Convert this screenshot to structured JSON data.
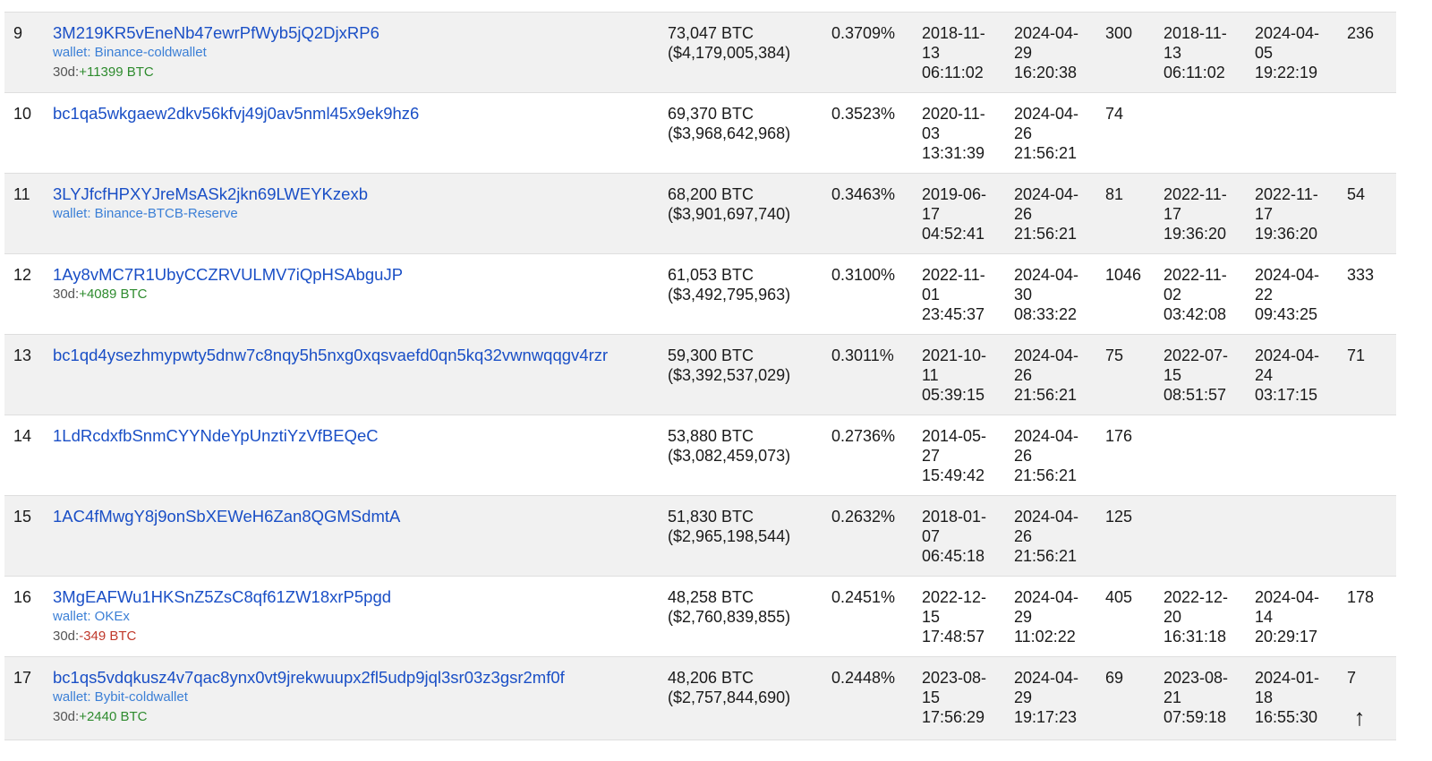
{
  "colors": {
    "link": "#1a4fc6",
    "wallet": "#3b7fd6",
    "positive": "#2e8b2e",
    "negative": "#c0392b",
    "row_shade": "#f1f1f1"
  },
  "rows": [
    {
      "rank": "9",
      "address": "3M219KR5vEneNb47ewrPfWyb5jQ2DjxRP6",
      "wallet": "wallet: Binance-coldwallet",
      "delta_prefix": "30d:",
      "delta": "+11399 BTC",
      "delta_sign": "pos",
      "balance": "73,047 BTC\n($4,179,005,384)",
      "pct": "0.3709%",
      "first_in": "2018-11-\n13\n06:11:02",
      "last_in": "2024-04-\n29\n16:20:38",
      "ins": "300",
      "first_out": "2018-11-\n13\n06:11:02",
      "last_out": "2024-04-\n05\n19:22:19",
      "outs": "236"
    },
    {
      "rank": "10",
      "address": "bc1qa5wkgaew2dkv56kfvj49j0av5nml45x9ek9hz6",
      "wallet": "",
      "delta_prefix": "",
      "delta": "",
      "delta_sign": "",
      "balance": "69,370 BTC\n($3,968,642,968)",
      "pct": "0.3523%",
      "first_in": "2020-11-\n03\n13:31:39",
      "last_in": "2024-04-\n26\n21:56:21",
      "ins": "74",
      "first_out": "",
      "last_out": "",
      "outs": ""
    },
    {
      "rank": "11",
      "address": "3LYJfcfHPXYJreMsASk2jkn69LWEYKzexb",
      "wallet": "wallet: Binance-BTCB-Reserve",
      "delta_prefix": "",
      "delta": "",
      "delta_sign": "",
      "balance": "68,200 BTC\n($3,901,697,740)",
      "pct": "0.3463%",
      "first_in": "2019-06-\n17\n04:52:41",
      "last_in": "2024-04-\n26\n21:56:21",
      "ins": "81",
      "first_out": "2022-11-\n17\n19:36:20",
      "last_out": "2022-11-\n17\n19:36:20",
      "outs": "54"
    },
    {
      "rank": "12",
      "address": "1Ay8vMC7R1UbyCCZRVULMV7iQpHSAbguJP",
      "wallet": "",
      "delta_prefix": "30d:",
      "delta": "+4089 BTC",
      "delta_sign": "pos",
      "balance": "61,053 BTC\n($3,492,795,963)",
      "pct": "0.3100%",
      "first_in": "2022-11-\n01\n23:45:37",
      "last_in": "2024-04-\n30\n08:33:22",
      "ins": "1046",
      "first_out": "2022-11-\n02\n03:42:08",
      "last_out": "2024-04-\n22\n09:43:25",
      "outs": "333"
    },
    {
      "rank": "13",
      "address": "bc1qd4ysezhmypwty5dnw7c8nqy5h5nxg0xqsvaefd0qn5kq32vwnwqqgv4rzr",
      "wallet": "",
      "delta_prefix": "",
      "delta": "",
      "delta_sign": "",
      "balance": "59,300 BTC\n($3,392,537,029)",
      "pct": "0.3011%",
      "first_in": "2021-10-\n11\n05:39:15",
      "last_in": "2024-04-\n26\n21:56:21",
      "ins": "75",
      "first_out": "2022-07-\n15\n08:51:57",
      "last_out": "2024-04-\n24\n03:17:15",
      "outs": "71"
    },
    {
      "rank": "14",
      "address": "1LdRcdxfbSnmCYYNdeYpUnztiYzVfBEQeC",
      "wallet": "",
      "delta_prefix": "",
      "delta": "",
      "delta_sign": "",
      "balance": "53,880 BTC\n($3,082,459,073)",
      "pct": "0.2736%",
      "first_in": "2014-05-\n27\n15:49:42",
      "last_in": "2024-04-\n26\n21:56:21",
      "ins": "176",
      "first_out": "",
      "last_out": "",
      "outs": ""
    },
    {
      "rank": "15",
      "address": "1AC4fMwgY8j9onSbXEWeH6Zan8QGMSdmtA",
      "wallet": "",
      "delta_prefix": "",
      "delta": "",
      "delta_sign": "",
      "balance": "51,830 BTC\n($2,965,198,544)",
      "pct": "0.2632%",
      "first_in": "2018-01-\n07\n06:45:18",
      "last_in": "2024-04-\n26\n21:56:21",
      "ins": "125",
      "first_out": "",
      "last_out": "",
      "outs": ""
    },
    {
      "rank": "16",
      "address": "3MgEAFWu1HKSnZ5ZsC8qf61ZW18xrP5pgd",
      "wallet": "wallet: OKEx",
      "delta_prefix": "30d:",
      "delta": "-349 BTC",
      "delta_sign": "neg",
      "balance": "48,258 BTC\n($2,760,839,855)",
      "pct": "0.2451%",
      "first_in": "2022-12-\n15\n17:48:57",
      "last_in": "2024-04-\n29\n11:02:22",
      "ins": "405",
      "first_out": "2022-12-\n20\n16:31:18",
      "last_out": "2024-04-\n14\n20:29:17",
      "outs": "178"
    },
    {
      "rank": "17",
      "address": "bc1qs5vdqkusz4v7qac8ynx0vt9jrekwuupx2fl5udp9jql3sr03z3gsr2mf0f",
      "wallet": "wallet: Bybit-coldwallet",
      "delta_prefix": "30d:",
      "delta": "+2440 BTC",
      "delta_sign": "pos",
      "balance": "48,206 BTC\n($2,757,844,690)",
      "pct": "0.2448%",
      "first_in": "2023-08-\n15\n17:56:29",
      "last_in": "2024-04-\n29\n19:17:23",
      "ins": "69",
      "first_out": "2023-08-\n21\n07:59:18",
      "last_out": "2024-01-\n18\n16:55:30",
      "outs": "7"
    }
  ],
  "scroll_top": {
    "glyph": "↑"
  }
}
